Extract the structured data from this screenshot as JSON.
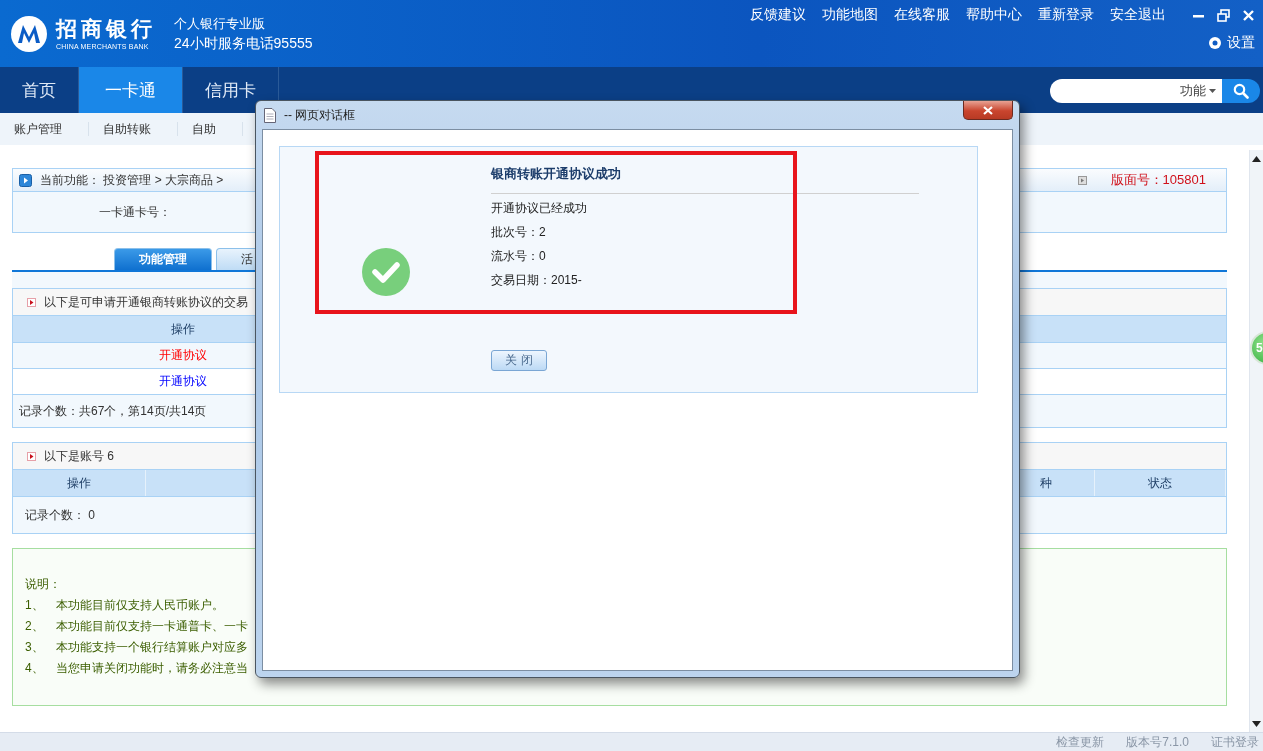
{
  "header": {
    "logo_name": "招商银行",
    "logo_sub": "CHINA MERCHANTS BANK",
    "edition": "个人银行专业版",
    "hotline": "24小时服务电话95555",
    "links": [
      "反馈建议",
      "功能地图",
      "在线客服",
      "帮助中心",
      "重新登录",
      "安全退出"
    ],
    "settings": "设置"
  },
  "nav": {
    "items": [
      {
        "label": "首页",
        "selected": false
      },
      {
        "label": "一卡通",
        "selected": true
      },
      {
        "label": "信用卡",
        "selected": false
      }
    ],
    "search_scope": "功能"
  },
  "subnav": [
    "账户管理",
    "自助转账",
    "自助"
  ],
  "breadcrumb": "当前功能： 投资管理 > 大宗商品 >",
  "page_number": "版面号：105801",
  "card_label": "一卡通卡号：",
  "tabs": [
    {
      "label": "功能管理",
      "selected": true
    },
    {
      "label": "活",
      "selected": false
    }
  ],
  "agreements": {
    "caption": "以下是可申请开通银商转账协议的交易",
    "columns": [
      "操作"
    ],
    "rows": [
      {
        "action": "开通协议",
        "selected": true
      },
      {
        "action": "开通协议",
        "selected": false
      }
    ],
    "record_count": "记录个数：共67个，第14页/共14页"
  },
  "account_section": {
    "caption": "以下是账号 6",
    "columns": [
      "操作",
      "种",
      "状态"
    ],
    "record_count": "记录个数： 0"
  },
  "notes": {
    "title": "说明：",
    "items": [
      {
        "number": "1、",
        "text": "本功能目前仅支持人民币账户。"
      },
      {
        "number": "2、",
        "text": "本功能目前仅支持一卡通普卡、一卡"
      },
      {
        "number": "3、",
        "text": "本功能支持一个银行结算账户对应多"
      },
      {
        "number": "4、",
        "text": "当您申请关闭功能时，请务必注意当"
      }
    ]
  },
  "dialog": {
    "title": "-- 网页对话框",
    "heading": "银商转账开通协议成功",
    "lines": [
      "开通协议已经成功",
      "批次号：2",
      "流水号：0",
      "交易日期：2015-"
    ],
    "close_button": "关 闭"
  },
  "side_badge": "5",
  "status_bar": [
    "检查更新",
    "版本号7.1.0",
    "证书登录"
  ]
}
